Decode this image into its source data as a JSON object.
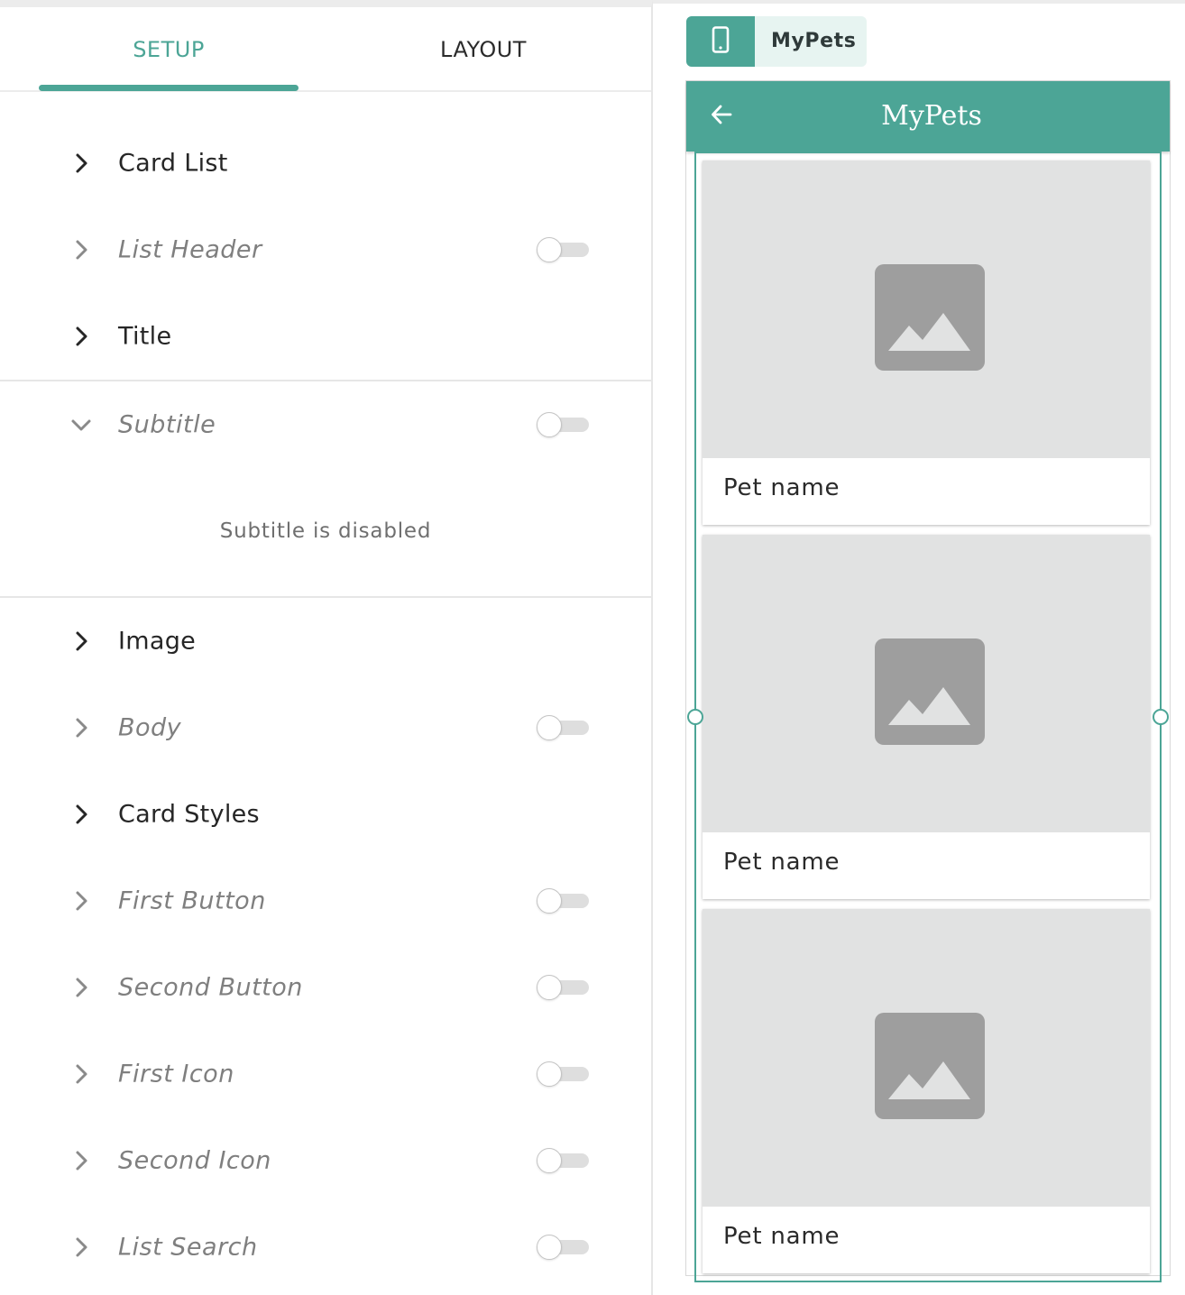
{
  "tabs": [
    {
      "label": "SETUP",
      "active": true
    },
    {
      "label": "LAYOUT",
      "active": false
    }
  ],
  "sections": [
    {
      "label": "Card List",
      "expanded": false,
      "enabled": true,
      "has_toggle": false
    },
    {
      "label": "List Header",
      "expanded": false,
      "enabled": false,
      "has_toggle": true,
      "toggle_on": false
    },
    {
      "label": "Title",
      "expanded": false,
      "enabled": true,
      "has_toggle": false
    },
    {
      "label": "Subtitle",
      "expanded": true,
      "enabled": false,
      "has_toggle": true,
      "toggle_on": false,
      "message": "Subtitle is disabled"
    },
    {
      "label": "Image",
      "expanded": false,
      "enabled": true,
      "has_toggle": false
    },
    {
      "label": "Body",
      "expanded": false,
      "enabled": false,
      "has_toggle": true,
      "toggle_on": false
    },
    {
      "label": "Card Styles",
      "expanded": false,
      "enabled": true,
      "has_toggle": false
    },
    {
      "label": "First Button",
      "expanded": false,
      "enabled": false,
      "has_toggle": true,
      "toggle_on": false
    },
    {
      "label": "Second Button",
      "expanded": false,
      "enabled": false,
      "has_toggle": true,
      "toggle_on": false
    },
    {
      "label": "First Icon",
      "expanded": false,
      "enabled": false,
      "has_toggle": true,
      "toggle_on": false
    },
    {
      "label": "Second Icon",
      "expanded": false,
      "enabled": false,
      "has_toggle": true,
      "toggle_on": false
    },
    {
      "label": "List Search",
      "expanded": false,
      "enabled": false,
      "has_toggle": true,
      "toggle_on": false
    }
  ],
  "device": {
    "icon": "phone-icon",
    "app_name": "MyPets"
  },
  "preview": {
    "appbar_title": "MyPets",
    "back_icon": "arrow-left-icon",
    "cards": [
      {
        "title": "Pet name",
        "image": "image-placeholder-icon"
      },
      {
        "title": "Pet name",
        "image": "image-placeholder-icon"
      },
      {
        "title": "Pet name",
        "image": "image-placeholder-icon"
      }
    ]
  },
  "colors": {
    "accent": "#4ca596",
    "accent_light": "#e7f4f1",
    "image_placeholder_bg": "#e1e2e2",
    "image_placeholder_icon": "#9e9e9e"
  }
}
